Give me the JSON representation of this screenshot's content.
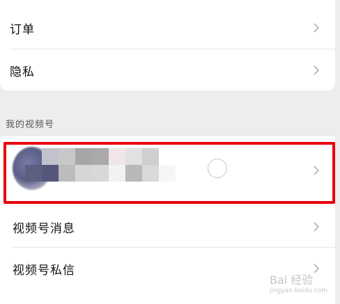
{
  "menu_top": {
    "items": [
      {
        "label": "订单"
      },
      {
        "label": "隐私"
      }
    ]
  },
  "section": {
    "label": "我的视频号"
  },
  "menu_bottom": {
    "items": [
      {
        "label": "视频号消息"
      },
      {
        "label": "视频号私信"
      }
    ]
  },
  "watermark": {
    "brand": "Bai 经验",
    "url": "jingyan.baidu.com"
  },
  "colors": {
    "highlight": "#e8000b",
    "background": "#ededed",
    "card": "#ffffff"
  }
}
